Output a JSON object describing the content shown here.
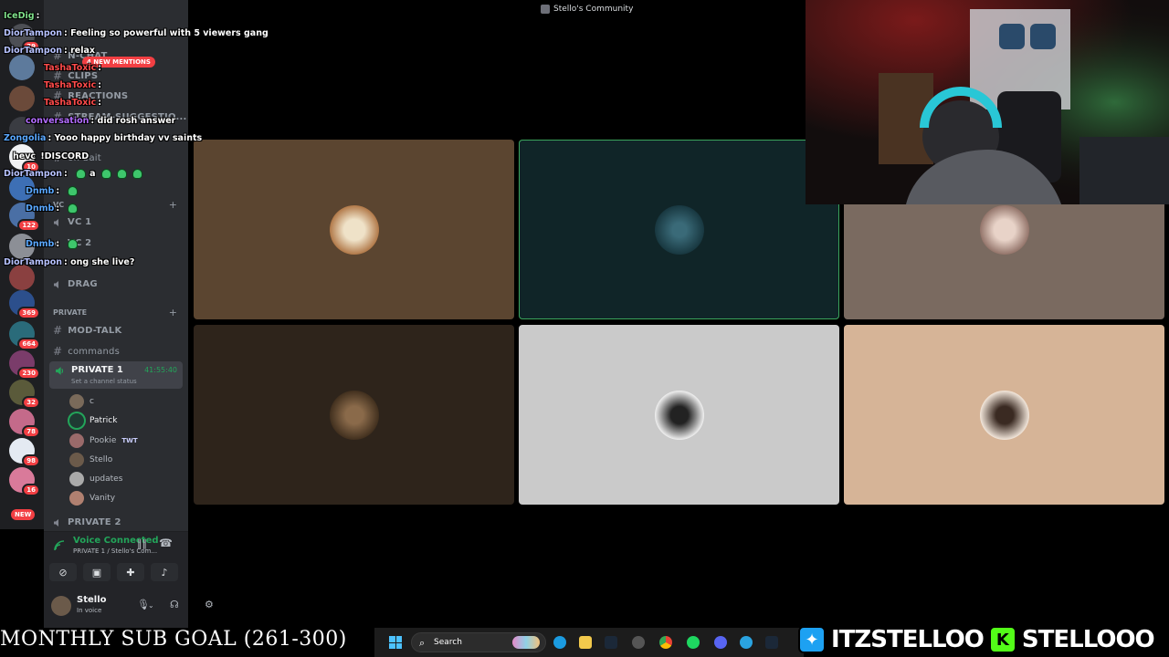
{
  "window": {
    "title": "Stello's Community"
  },
  "chat": {
    "messages": [
      {
        "user": "IceDig",
        "text": "",
        "color": "#7fe08a"
      },
      {
        "user": "DiorTampon",
        "text": "Feeling so powerful with 5 viewers gang",
        "color": "#b7c2ff"
      },
      {
        "user": "DiorTampon",
        "text": "relax",
        "color": "#b7c2ff"
      },
      {
        "user": "TashaToxic",
        "text": "",
        "color": "#ff4b4b"
      },
      {
        "user": "TashaToxic",
        "text": "",
        "color": "#ff4b4b"
      },
      {
        "user": "TashaToxic",
        "text": "",
        "color": "#ff4b4b"
      },
      {
        "user": "conversation",
        "text": "did rosh answer",
        "color": "#b26cff"
      },
      {
        "user": "Zongolia",
        "text": "Yooo happy birthday vv saints",
        "color": "#5aa8ff"
      },
      {
        "user": "hevc",
        "text": "!DISCORD",
        "color": "#ffffff"
      },
      {
        "user": "DiorTampon",
        "text": "a",
        "color": "#b7c2ff"
      },
      {
        "user": "Dnmb",
        "text": "",
        "color": "#5aa8ff"
      },
      {
        "user": "Dnmb",
        "text": "",
        "color": "#5aa8ff"
      },
      {
        "user": "Dnmb",
        "text": "",
        "color": "#5aa8ff"
      },
      {
        "user": "DiorTampon",
        "text": "ong she live?",
        "color": "#b7c2ff"
      }
    ],
    "mentions": "4 NEW MENTIONS"
  },
  "sidebar": {
    "channels_top": [
      "N-CHAT",
      "CLIPS",
      "REACTIONS",
      "STREAM-SUGGESTIO...",
      "on-bait"
    ],
    "vc_category": "VC",
    "vc_channels": [
      "VC 1",
      "VC 2",
      "",
      "DRAG"
    ],
    "private_category": "PRIVATE",
    "private_text_channels": [
      "MOD-TALK",
      "commands"
    ],
    "active_channel": {
      "name": "PRIVATE 1",
      "timer": "41:55:40",
      "status": "Set a channel status"
    },
    "voice_users": [
      {
        "name": "c",
        "tag": ""
      },
      {
        "name": "Patrick",
        "tag": "",
        "speaking": true
      },
      {
        "name": "Pookie",
        "tag": "TWT"
      },
      {
        "name": "Stello",
        "tag": ""
      },
      {
        "name": "updates",
        "tag": ""
      },
      {
        "name": "Vanity",
        "tag": ""
      }
    ],
    "next_channel": "PRIVATE 2"
  },
  "rail": {
    "badges": [
      "29",
      "10",
      "122",
      "369",
      "664",
      "230",
      "32",
      "78",
      "98",
      "16"
    ],
    "new_label": "NEW"
  },
  "voice_panel": {
    "status": "Voice Connected",
    "location": "PRIVATE 1 / Stello's Com..."
  },
  "user_panel": {
    "name": "Stello",
    "status": "In voice"
  },
  "stream": {
    "sub_goal": "MONTHLY SUB GOAL (261-300)",
    "twitter": "ITZSTELLOO",
    "kick": "STELLOOO"
  },
  "taskbar": {
    "search_label": "Search"
  },
  "colors": {
    "accent_green": "#23a55a",
    "tile_colors": [
      "#5b4530",
      "#102528",
      "#7a6a60",
      "#2e241b",
      "#cacaca",
      "#d6b497"
    ]
  }
}
